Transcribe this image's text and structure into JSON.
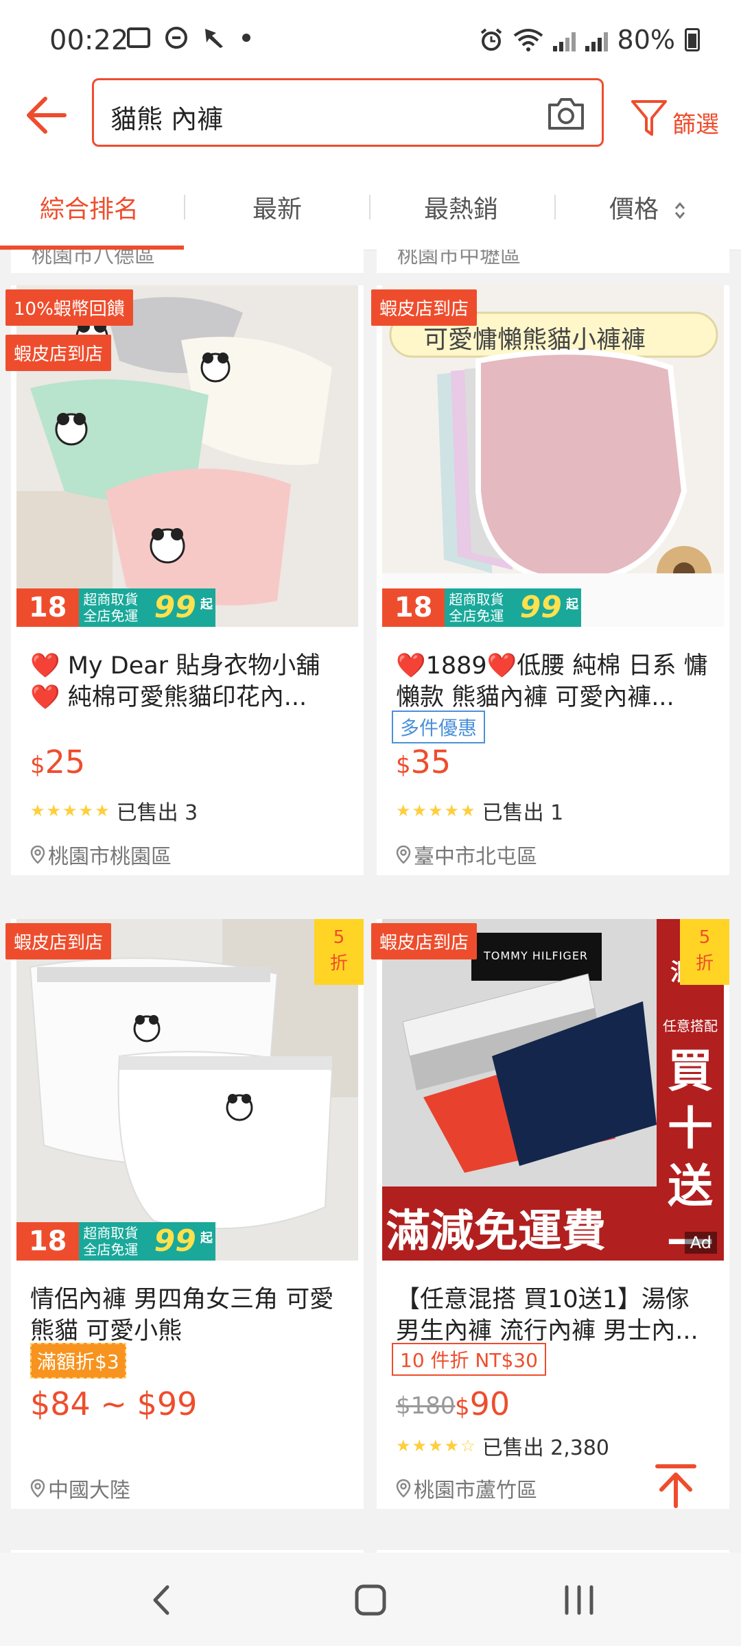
{
  "status": {
    "time": "00:22",
    "battery": "80%"
  },
  "search": {
    "query": "貓熊 內褲",
    "filter_label": "篩選"
  },
  "tabs": [
    {
      "label": "綜合排名",
      "active": true
    },
    {
      "label": "最新",
      "active": false
    },
    {
      "label": "最熱銷",
      "active": false
    },
    {
      "label": "價格",
      "active": false
    }
  ],
  "products": [
    {
      "badges": [
        "10%蝦幣回饋",
        "蝦皮店到店"
      ],
      "promo": {
        "left": "18號",
        "mid_line1": "超商取貨",
        "mid_line2": "全店免運",
        "big": "99",
        "suffix": "起"
      },
      "title": "❤️ My Dear 貼身衣物小舖❤️  純棉可愛熊貓印花內...",
      "price": "25",
      "currency": "$",
      "sold": "已售出 3",
      "rating": 5,
      "location": "桃園市桃園區"
    },
    {
      "badges": [
        "蝦皮店到店"
      ],
      "image_caption": "可愛慵懶熊貓小褲褲",
      "promo": {
        "left": "18號",
        "mid_line1": "超商取貨",
        "mid_line2": "全店免運",
        "big": "99",
        "suffix": "起"
      },
      "title": "❤️1889❤️低腰 純棉 日系 慵懶款 熊貓內褲 可愛內褲...",
      "tag": "多件優惠",
      "price": "35",
      "currency": "$",
      "sold": "已售出 1",
      "rating": 5,
      "location": "臺中市北屯區"
    },
    {
      "badges": [
        "蝦皮店到店"
      ],
      "discount": {
        "line1": "5",
        "line2": "折"
      },
      "promo": {
        "left": "18號",
        "mid_line1": "超商取貨",
        "mid_line2": "全店免運",
        "big": "99",
        "suffix": "起"
      },
      "title": "情侶內褲 男四角女三角 可愛熊貓 可愛小熊",
      "tag": "滿額折$3",
      "price": "$84 ~ $99",
      "location": "中國大陸"
    },
    {
      "badges": [
        "蝦皮店到店"
      ],
      "discount": {
        "line1": "5",
        "line2": "折"
      },
      "image_text": {
        "banner": "滿減免運費",
        "side": "買十送一",
        "side_top": "任意搭配",
        "corner": "混搭",
        "brand": "TOMMY HILFIGER"
      },
      "ad": "Ad",
      "title": "【任意混搭 買10送1】湯傢 男生內褲 流行內褲 男士內...",
      "tag": "10 件折 NT$30",
      "old_price": "$180",
      "price": "90",
      "currency": "$",
      "sold": "已售出 2,380",
      "rating": 4.5,
      "location": "桃園市蘆竹區"
    }
  ],
  "partial_top": {
    "left": "桃園市八德區",
    "right": "桃園市中壢區"
  },
  "colors": {
    "brand": "#ee4d2d",
    "promo_teal": "#1aa89a",
    "discount_yellow": "#ffd424",
    "star": "#ffce3d"
  }
}
